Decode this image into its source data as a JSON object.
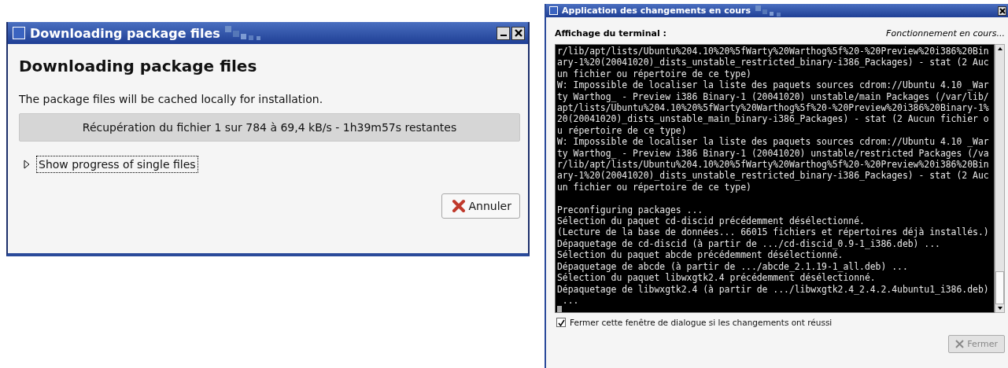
{
  "download_window": {
    "title": "Downloading package files",
    "heading": "Downloading package files",
    "description": "The package files will be cached locally for installation.",
    "progress": {
      "level": 0,
      "text": "Récupération du fichier 1 sur 784 à 69,4 kB/s - 1h39m57s restantes"
    },
    "expander": {
      "label": "Show progress of single files",
      "expanded": false
    },
    "cancel_button": "Annuler"
  },
  "changes_window": {
    "title": "Application des changements en cours",
    "terminal_label": "Affichage du terminal :",
    "status": "Fonctionnement en cours...",
    "terminal_blocks": [
      [
        "r/lib/apt/lists/Ubuntu%204.10%20%5fWarty%20Warthog%5f%20-%20Preview%20i386%20Bin",
        "ary-1%20(20041020)_dists_unstable_restricted_binary-i386_Packages) - stat (2 Auc",
        "un fichier ou répertoire de ce type)",
        "W: Impossible de localiser la liste des paquets sources cdrom://Ubuntu 4.10 _War",
        "ty Warthog_ - Preview i386 Binary-1 (20041020) unstable/main Packages (/var/lib/",
        "apt/lists/Ubuntu%204.10%20%5fWarty%20Warthog%5f%20-%20Preview%20i386%20Binary-1%",
        "20(20041020)_dists_unstable_main_binary-i386_Packages) - stat (2 Aucun fichier o",
        "u répertoire de ce type)",
        "W: Impossible de localiser la liste des paquets sources cdrom://Ubuntu 4.10 _War",
        "ty Warthog_ - Preview i386 Binary-1 (20041020) unstable/restricted Packages (/va",
        "r/lib/apt/lists/Ubuntu%204.10%20%5fWarty%20Warthog%5f%20-%20Preview%20i386%20Bin",
        "ary-1%20(20041020)_dists_unstable_restricted_binary-i386_Packages) - stat (2 Auc",
        "un fichier ou répertoire de ce type)"
      ],
      [
        "Preconfiguring packages ...",
        "Sélection du paquet cd-discid précédemment désélectionné.",
        "(Lecture de la base de données... 66015 fichiers et répertoires déjà installés.)",
        "Dépaquetage de cd-discid (à partir de .../cd-discid_0.9-1_i386.deb) ...",
        "Sélection du paquet abcde précédemment désélectionné.",
        "Dépaquetage de abcde (à partir de .../abcde_2.1.19-1_all.deb) ...",
        "Sélection du paquet libwxgtk2.4 précédemment désélectionné.",
        "Dépaquetage de libwxgtk2.4 (à partir de .../libwxgtk2.4_2.4.2.4ubuntu1_i386.deb)",
        " ..."
      ]
    ],
    "close_checkbox": {
      "label": "Fermer cette fenêtre de dialogue si les changements ont réussi",
      "checked": true
    },
    "close_button": {
      "label": "Fermer",
      "disabled": true
    }
  }
}
